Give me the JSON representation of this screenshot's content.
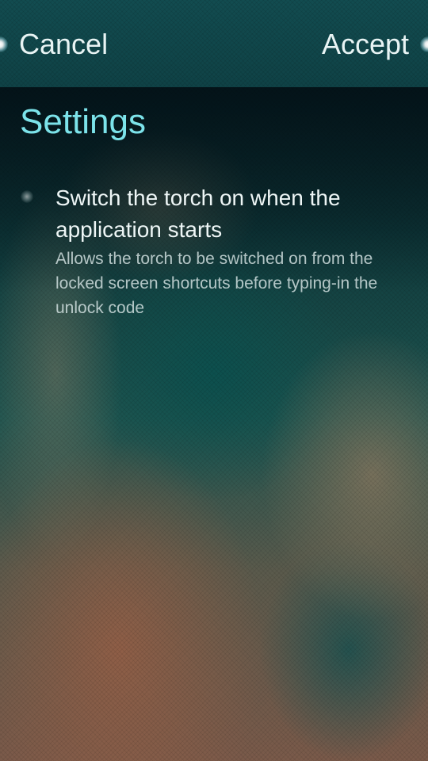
{
  "header": {
    "cancel_label": "Cancel",
    "accept_label": "Accept"
  },
  "page": {
    "title": "Settings"
  },
  "settings": {
    "torch_switch": {
      "label": "Switch the torch on when the application starts",
      "description": "Allows the torch to be switched on from the locked screen shortcuts before typing-in the unlock code",
      "checked": false
    }
  },
  "colors": {
    "accent": "#7ce3ea",
    "header_bg": "#124c50",
    "primary_text": "#eef6f6"
  }
}
